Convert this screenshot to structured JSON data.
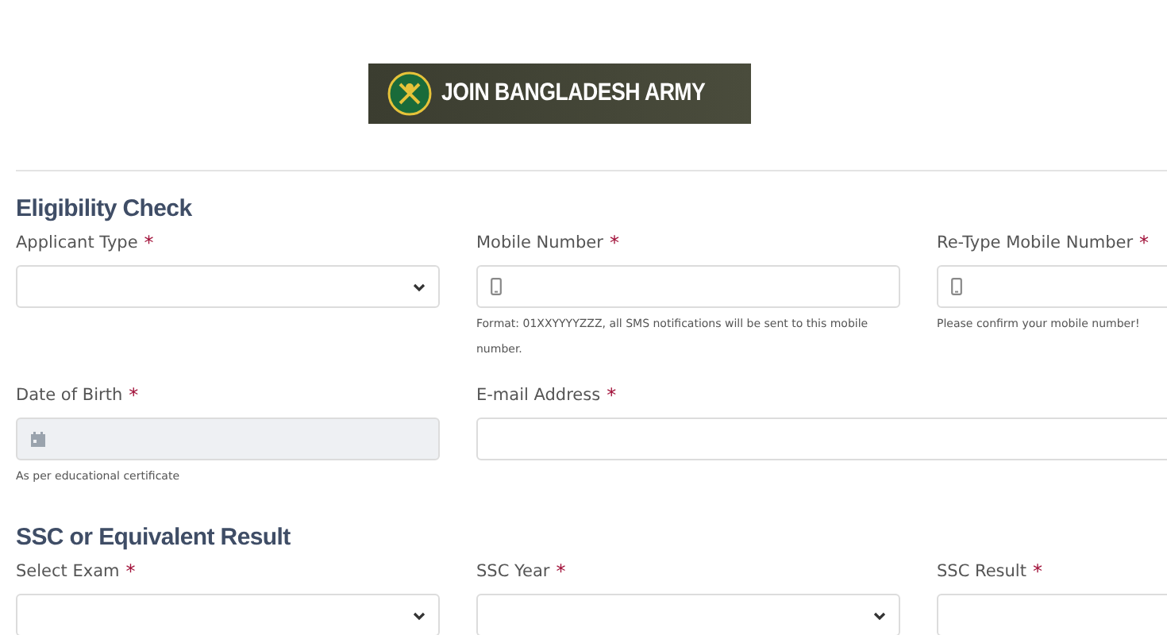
{
  "logo": {
    "text": "JOIN BANGLADESH ARMY"
  },
  "sections": [
    {
      "title": "Eligibility Check",
      "fields": [
        {
          "kind": "select",
          "label": "Applicant Type",
          "mark": "*"
        },
        {
          "kind": "phone",
          "label": "Mobile Number",
          "mark": "*",
          "help": "Format: 01XXYYYYZZZ, all SMS notifications will be sent to this mobile number."
        },
        {
          "kind": "phone",
          "label": "Re-Type Mobile Number",
          "mark": "*",
          "help": "Please confirm your mobile number!"
        },
        {
          "kind": "date",
          "label": "Date of Birth",
          "mark": "*",
          "help": "As per educational certificate"
        },
        {
          "kind": "email",
          "label": "E-mail Address",
          "mark": "*"
        }
      ]
    },
    {
      "title": "SSC or Equivalent Result",
      "fields": [
        {
          "kind": "select",
          "label": "Select Exam",
          "mark": "*"
        },
        {
          "kind": "select",
          "label": "SSC Year",
          "mark": "*"
        },
        {
          "kind": "text",
          "label": "SSC Result",
          "mark": "*"
        }
      ]
    }
  ]
}
